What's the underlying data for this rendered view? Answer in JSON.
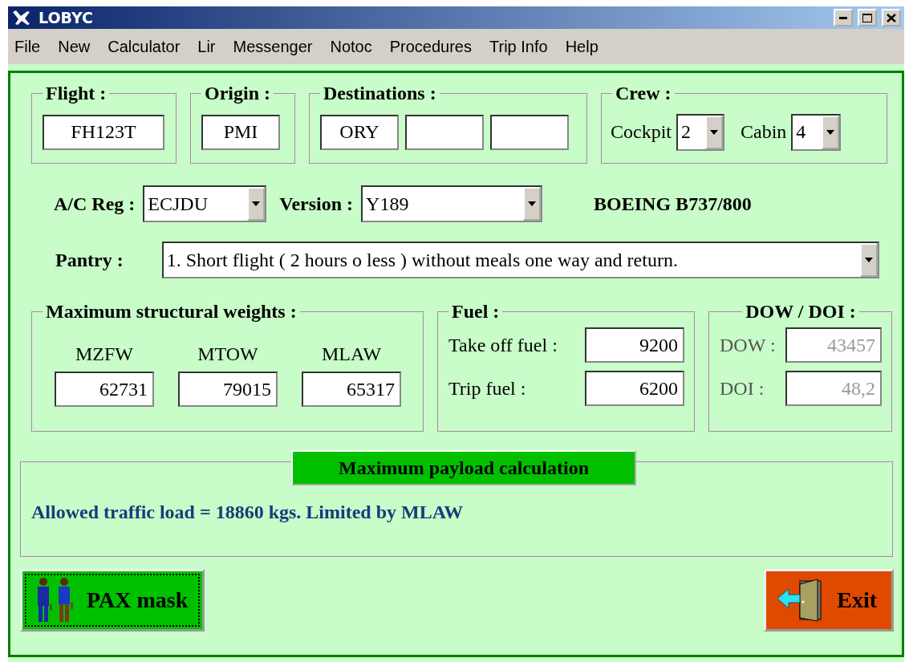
{
  "window": {
    "title": "LOBYC"
  },
  "menu": [
    "File",
    "New",
    "Calculator",
    "Lir",
    "Messenger",
    "Notoc",
    "Procedures",
    "Trip Info",
    "Help"
  ],
  "flight": {
    "legend": "Flight :",
    "value": "FH123T"
  },
  "origin": {
    "legend": "Origin :",
    "value": "PMI"
  },
  "destinations": {
    "legend": "Destinations :",
    "value": "ORY"
  },
  "crew": {
    "legend": "Crew :",
    "fields": [
      {
        "label": "Cockpit",
        "value": "2"
      },
      {
        "label": "Cabin",
        "value": "4"
      }
    ]
  },
  "ac_reg": {
    "label": "A/C Reg :",
    "value": "ECJDU"
  },
  "version": {
    "label": "Version :",
    "value": "Y189"
  },
  "aircraft": "BOEING B737/800",
  "pantry": {
    "label": "Pantry :",
    "value": "1. Short flight ( 2 hours o less ) without meals one way and return."
  },
  "weights": {
    "legend": "Maximum structural weights :",
    "items": [
      {
        "label": "MZFW",
        "value": "62731"
      },
      {
        "label": "MTOW",
        "value": "79015"
      },
      {
        "label": "MLAW",
        "value": "65317"
      }
    ]
  },
  "fuel": {
    "legend": "Fuel :",
    "items": [
      {
        "label": "Take off fuel :",
        "value": "9200"
      },
      {
        "label": "Trip fuel :",
        "value": "6200"
      }
    ]
  },
  "dow_doi": {
    "legend": "DOW / DOI :",
    "items": [
      {
        "label": "DOW :",
        "value": "43457",
        "disabled": true
      },
      {
        "label": "DOI :",
        "value": "48,2",
        "disabled": true
      }
    ]
  },
  "payload": {
    "button": "Maximum payload calculation",
    "result": "Allowed traffic load = 18860 kgs. Limited by MLAW"
  },
  "buttons": {
    "pax": "PAX mask",
    "exit": "Exit"
  }
}
